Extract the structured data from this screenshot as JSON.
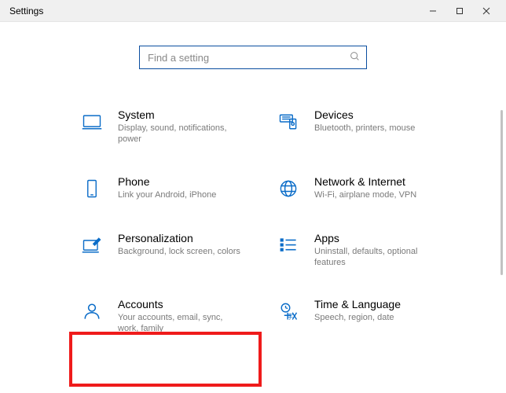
{
  "window": {
    "title": "Settings"
  },
  "search": {
    "placeholder": "Find a setting"
  },
  "categories": [
    {
      "id": "system",
      "title": "System",
      "desc": "Display, sound, notifications, power"
    },
    {
      "id": "devices",
      "title": "Devices",
      "desc": "Bluetooth, printers, mouse"
    },
    {
      "id": "phone",
      "title": "Phone",
      "desc": "Link your Android, iPhone"
    },
    {
      "id": "network",
      "title": "Network & Internet",
      "desc": "Wi-Fi, airplane mode, VPN"
    },
    {
      "id": "personalization",
      "title": "Personalization",
      "desc": "Background, lock screen, colors"
    },
    {
      "id": "apps",
      "title": "Apps",
      "desc": "Uninstall, defaults, optional features"
    },
    {
      "id": "accounts",
      "title": "Accounts",
      "desc": "Your accounts, email, sync, work, family"
    },
    {
      "id": "time",
      "title": "Time & Language",
      "desc": "Speech, region, date"
    }
  ],
  "highlighted": "accounts"
}
